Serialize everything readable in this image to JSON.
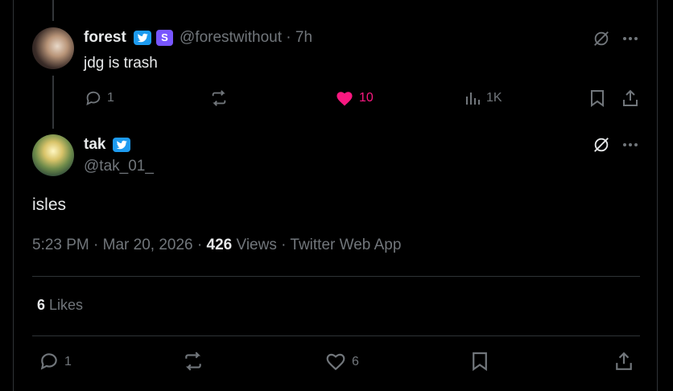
{
  "reply": {
    "author_name": "forest",
    "sub_badge": "S",
    "handle_time": "@forestwithout · 7h",
    "text": "jdg is trash",
    "actions": {
      "replies": "1",
      "likes": "10",
      "views": "1K"
    },
    "liked": true
  },
  "main_tweet": {
    "author_name": "tak",
    "handle": "@tak_01_",
    "text": "isles",
    "time": "5:23 PM",
    "date": "Mar 20, 2026",
    "views_count": "426",
    "views_label": "Views",
    "source": "Twitter Web App",
    "likes_count": "6",
    "likes_label": "Likes",
    "actions": {
      "replies": "1",
      "likes": "6"
    }
  },
  "colors": {
    "accent": "#1d9bf0",
    "like": "#f91880",
    "subscriber": "#7856ff",
    "muted": "#71767b"
  }
}
